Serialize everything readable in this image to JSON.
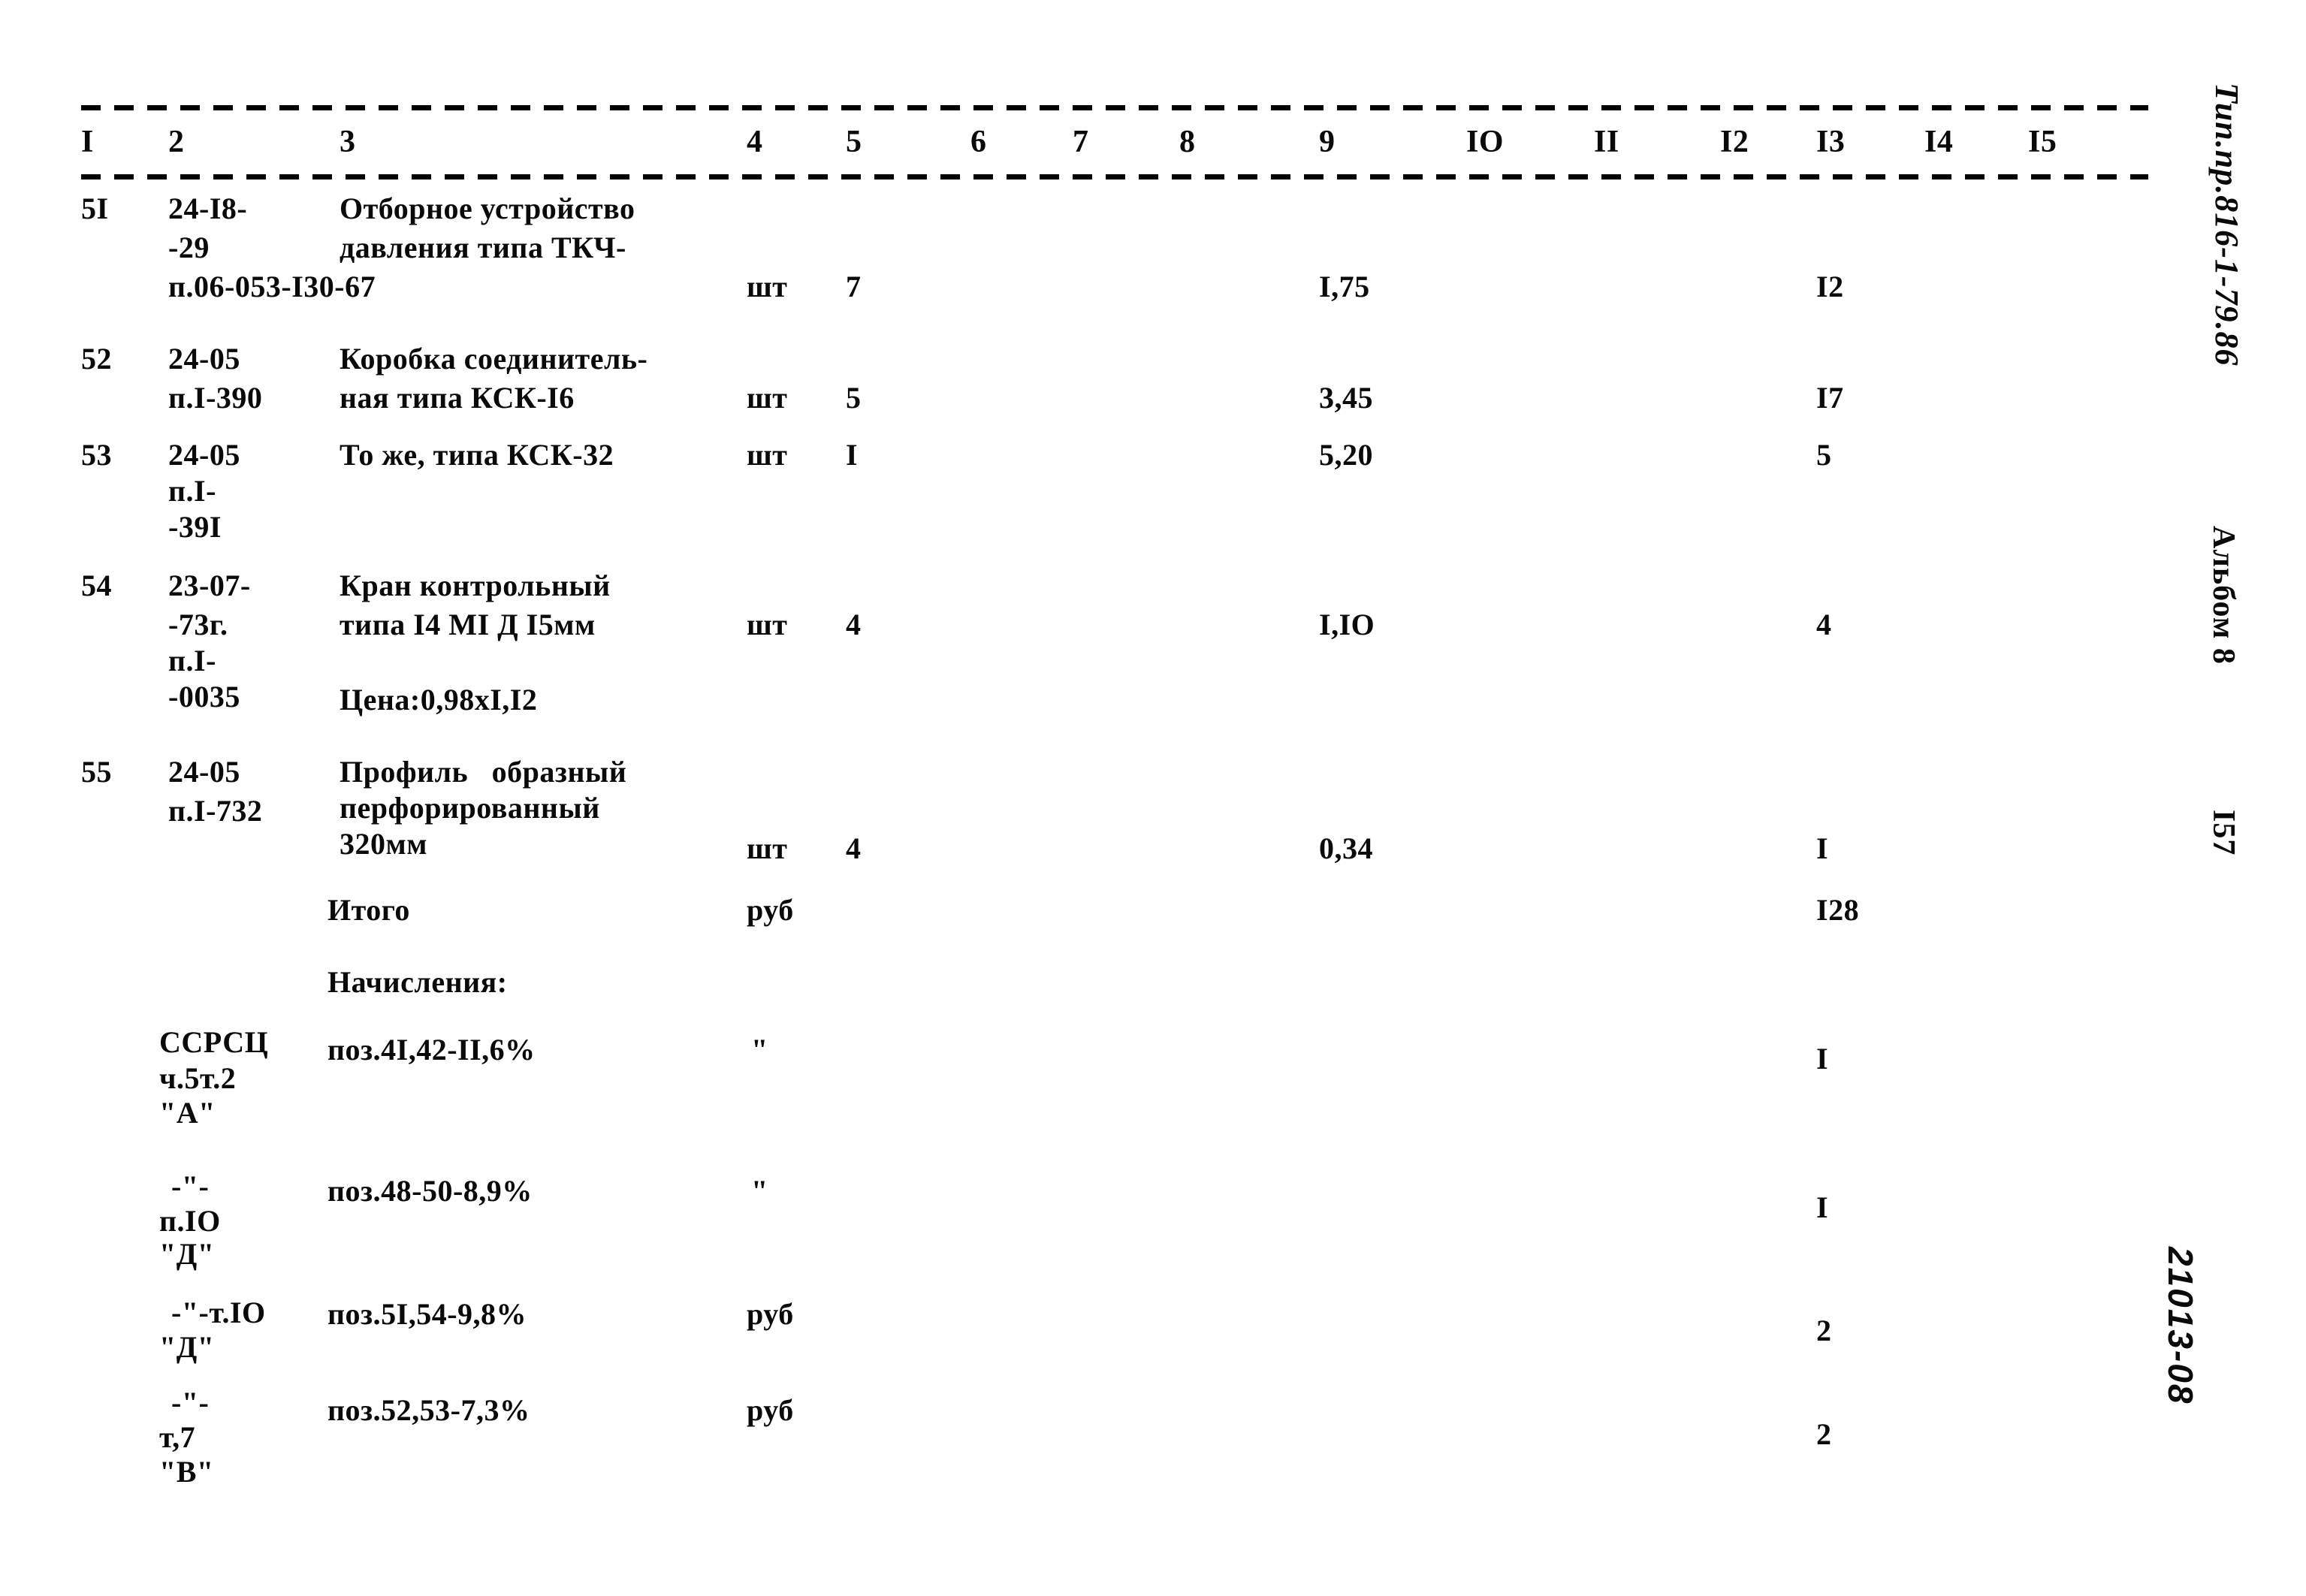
{
  "document": {
    "page_number": "I57",
    "side_title": "Тип.пр.816-1-79.86",
    "side_album": "Альбом 8",
    "side_code": "21013-08"
  },
  "table": {
    "column_headers": [
      "I",
      "2",
      "3",
      "4",
      "5",
      "6",
      "7",
      "8",
      "9",
      "IO",
      "II",
      "I2",
      "I3",
      "I4",
      "I5"
    ],
    "rows": [
      {
        "pos": "5I",
        "code_lines": [
          "24-I8-",
          "-29",
          "п.06-053-I30-67"
        ],
        "name_lines": [
          "Отборное устройство",
          "давления типа ТКЧ-"
        ],
        "unit": "шт",
        "qty": "7",
        "price": "I,75",
        "total": "I2"
      },
      {
        "pos": "52",
        "code_lines": [
          "24-05",
          "п.I-390"
        ],
        "name_lines": [
          "Коробка соединитель-",
          "ная типа КСК-I6"
        ],
        "unit": "шт",
        "qty": "5",
        "price": "3,45",
        "total": "I7"
      },
      {
        "pos": "53",
        "code_lines": [
          "24-05",
          "п.I-",
          "-39I"
        ],
        "name_lines": [
          "То же, типа КСК-32"
        ],
        "unit": "шт",
        "qty": "I",
        "price": "5,20",
        "total": "5"
      },
      {
        "pos": "54",
        "code_lines": [
          "23-07-",
          "-73г.",
          "п.I-",
          "-0035"
        ],
        "name_lines": [
          "Кран контрольный",
          "типа I4 МI Д I5мм"
        ],
        "note": "Цена:0,98хI,I2",
        "unit": "шт",
        "qty": "4",
        "price": "I,IO",
        "total": "4"
      },
      {
        "pos": "55",
        "code_lines": [
          "24-05",
          "п.I-732"
        ],
        "name_lines": [
          "Профиль   образный",
          "перфорированный",
          "320мм"
        ],
        "unit": "шт",
        "qty": "4",
        "price": "0,34",
        "total": "I"
      }
    ],
    "summary": {
      "itogo_label": "Итого",
      "itogo_unit": "руб",
      "itogo_total": "I28",
      "accruals_label": "Начисления:"
    },
    "accruals": [
      {
        "ref_lines": [
          "ССРСЦ",
          "ч.5т.2",
          "\"А\""
        ],
        "description": "поз.4I,42-II,6%",
        "unit": "\"",
        "total": "I"
      },
      {
        "ref_lines": [
          "-\"-",
          "п.IO",
          "\"Д\""
        ],
        "description": "поз.48-50-8,9%",
        "unit": "\"",
        "total": "I"
      },
      {
        "ref_lines": [
          "-\"-т.IO",
          "\"Д\""
        ],
        "description": "поз.5I,54-9,8%",
        "unit": "руб",
        "total": "2"
      },
      {
        "ref_lines": [
          "-\"-",
          "т,7",
          "\"В\""
        ],
        "description": "поз.52,53-7,3%",
        "unit": "руб",
        "total": "2"
      }
    ]
  }
}
